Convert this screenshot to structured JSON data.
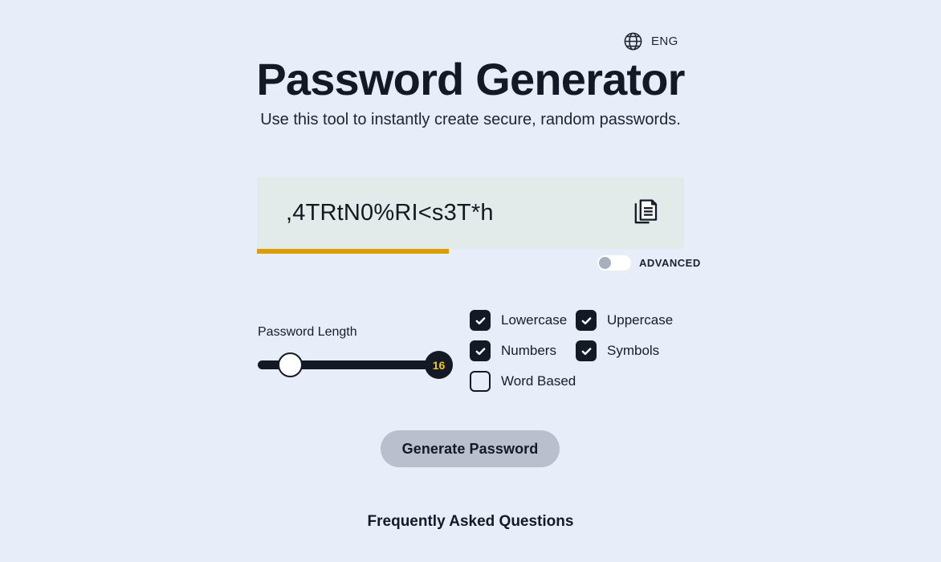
{
  "language": {
    "icon": "globe-icon",
    "label": "ENG"
  },
  "header": {
    "title": "Password Generator",
    "subtitle": "Use this tool to instantly create secure, random passwords."
  },
  "password_display": {
    "value": ",4TRtN0%RI<s3T*h",
    "copy_icon": "copy-icon",
    "strength": {
      "fill_percent": 45,
      "color": "#dd9c00"
    },
    "background_color": "#e2eaea"
  },
  "advanced": {
    "label": "ADVANCED",
    "enabled": false
  },
  "length_slider": {
    "label": "Password Length",
    "value": "16",
    "thumb_position_percent": 17,
    "value_color": "#f5c518",
    "track_color": "#131a26"
  },
  "options": [
    {
      "label": "Lowercase",
      "checked": true
    },
    {
      "label": "Uppercase",
      "checked": true
    },
    {
      "label": "Numbers",
      "checked": true
    },
    {
      "label": "Symbols",
      "checked": true
    },
    {
      "label": "Word Based",
      "checked": false
    }
  ],
  "actions": {
    "generate_label": "Generate Password",
    "generate_color": "#b9bfcd"
  },
  "faq": {
    "heading": "Frequently Asked Questions"
  },
  "theme": {
    "page_background": "#e8edfa",
    "text_color": "#131a26"
  }
}
